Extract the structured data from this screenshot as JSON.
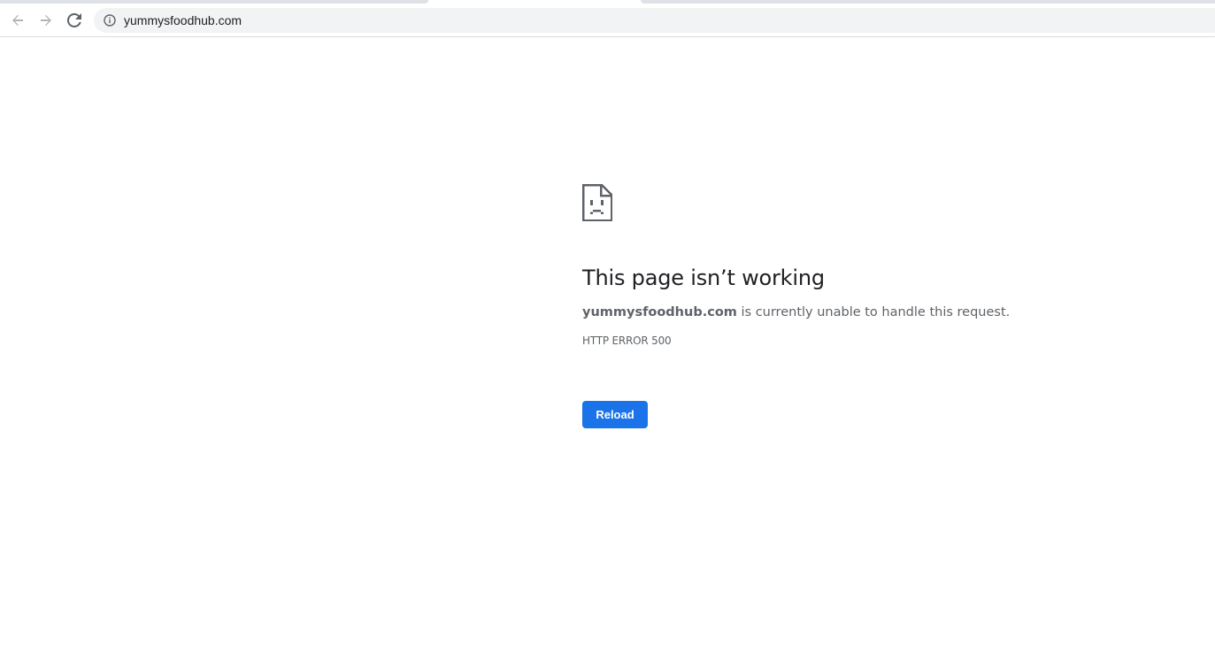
{
  "browser": {
    "url": "yummysfoodhub.com",
    "icons": {
      "back": "arrow-left-icon",
      "forward": "arrow-right-icon",
      "reload": "refresh-icon",
      "site_info": "info-icon"
    }
  },
  "error_page": {
    "icon": "sad-document-icon",
    "headline": "This page isn’t working",
    "host": "yummysfoodhub.com",
    "description_suffix": " is currently unable to handle this request.",
    "error_code": "HTTP ERROR 500",
    "reload_label": "Reload"
  },
  "colors": {
    "accent": "#1a73e8",
    "headline_text": "#202124",
    "body_text": "#5f6368",
    "omnibox_bg": "#f1f3f4"
  }
}
